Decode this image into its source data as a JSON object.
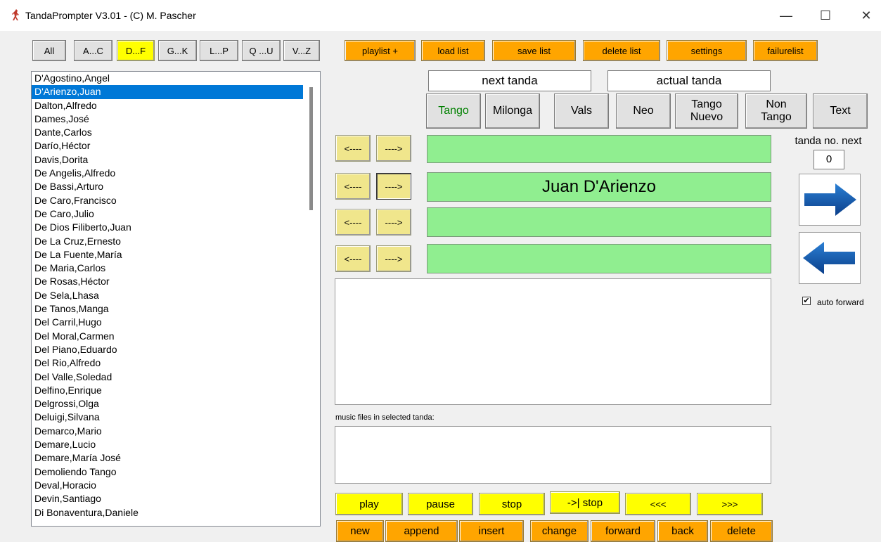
{
  "window": {
    "title": "TandaPrompter V3.01 - (C) M. Pascher"
  },
  "controls": {
    "minimize": "—",
    "maximize": "☐",
    "close": "✕"
  },
  "filters": [
    "All",
    "A...C",
    "D...F",
    "G...K",
    "L...P",
    "Q ...U",
    "V...Z"
  ],
  "active_filter": "D...F",
  "top_buttons": [
    "playlist +",
    "load list",
    "save list",
    "delete list",
    "settings",
    "failurelist"
  ],
  "orchestras": [
    "D'Agostino,Angel",
    "D'Arienzo,Juan",
    "Dalton,Alfredo",
    "Dames,José",
    "Dante,Carlos",
    "Darío,Héctor",
    "Davis,Dorita",
    "De Angelis,Alfredo",
    "De Bassi,Arturo",
    "De Caro,Francisco",
    "De Caro,Julio",
    "De Dios Filiberto,Juan",
    "De La Cruz,Ernesto",
    "De La Fuente,María",
    "De Maria,Carlos",
    "De Rosas,Héctor",
    "De Sela,Lhasa",
    "De Tanos,Manga",
    "Del Carril,Hugo",
    "Del Moral,Carmen",
    "Del Piano,Eduardo",
    "Del Rio,Alfredo",
    "Del Valle,Soledad",
    "Delfino,Enrique",
    "Delgrossi,Olga",
    "Deluigi,Silvana",
    "Demarco,Mario",
    "Demare,Lucio",
    "Demare,María José",
    "Demoliendo Tango",
    "Deval,Horacio",
    "Devin,Santiago",
    "Di Bonaventura,Daniele"
  ],
  "selected_orchestra": "D'Arienzo,Juan",
  "labels": {
    "next_tanda": "next tanda",
    "actual_tanda": "actual tanda",
    "tanda_no_next": "tanda no. next",
    "tanda_no_value": "0",
    "music_files": "music files in selected tanda:",
    "auto_forward": "auto forward"
  },
  "types": [
    {
      "line1": "Tango",
      "line2": ""
    },
    {
      "line1": "Milonga",
      "line2": ""
    },
    {
      "line1": "Vals",
      "line2": ""
    },
    {
      "line1": "Neo",
      "line2": ""
    },
    {
      "line1": "Tango",
      "line2": "Nuevo"
    },
    {
      "line1": "Non",
      "line2": "Tango"
    },
    {
      "line1": "Text",
      "line2": ""
    }
  ],
  "active_type_color": "#008000",
  "left_arrow": "<----",
  "right_arrow": "---->",
  "tanda_slots": [
    "",
    "Juan D'Arienzo",
    "",
    ""
  ],
  "auto_forward_checked": true,
  "play_buttons": [
    "play",
    "pause",
    "stop",
    "->| stop",
    "<<<",
    ">>>"
  ],
  "edit_buttons": [
    "new",
    "append",
    "insert",
    "change",
    "forward",
    "back",
    "delete"
  ],
  "colors": {
    "accent": "#0078d7",
    "green": "#90ee90",
    "yellow": "#ffff00",
    "orange": "#ffa500",
    "khaki": "#f0e68c"
  }
}
